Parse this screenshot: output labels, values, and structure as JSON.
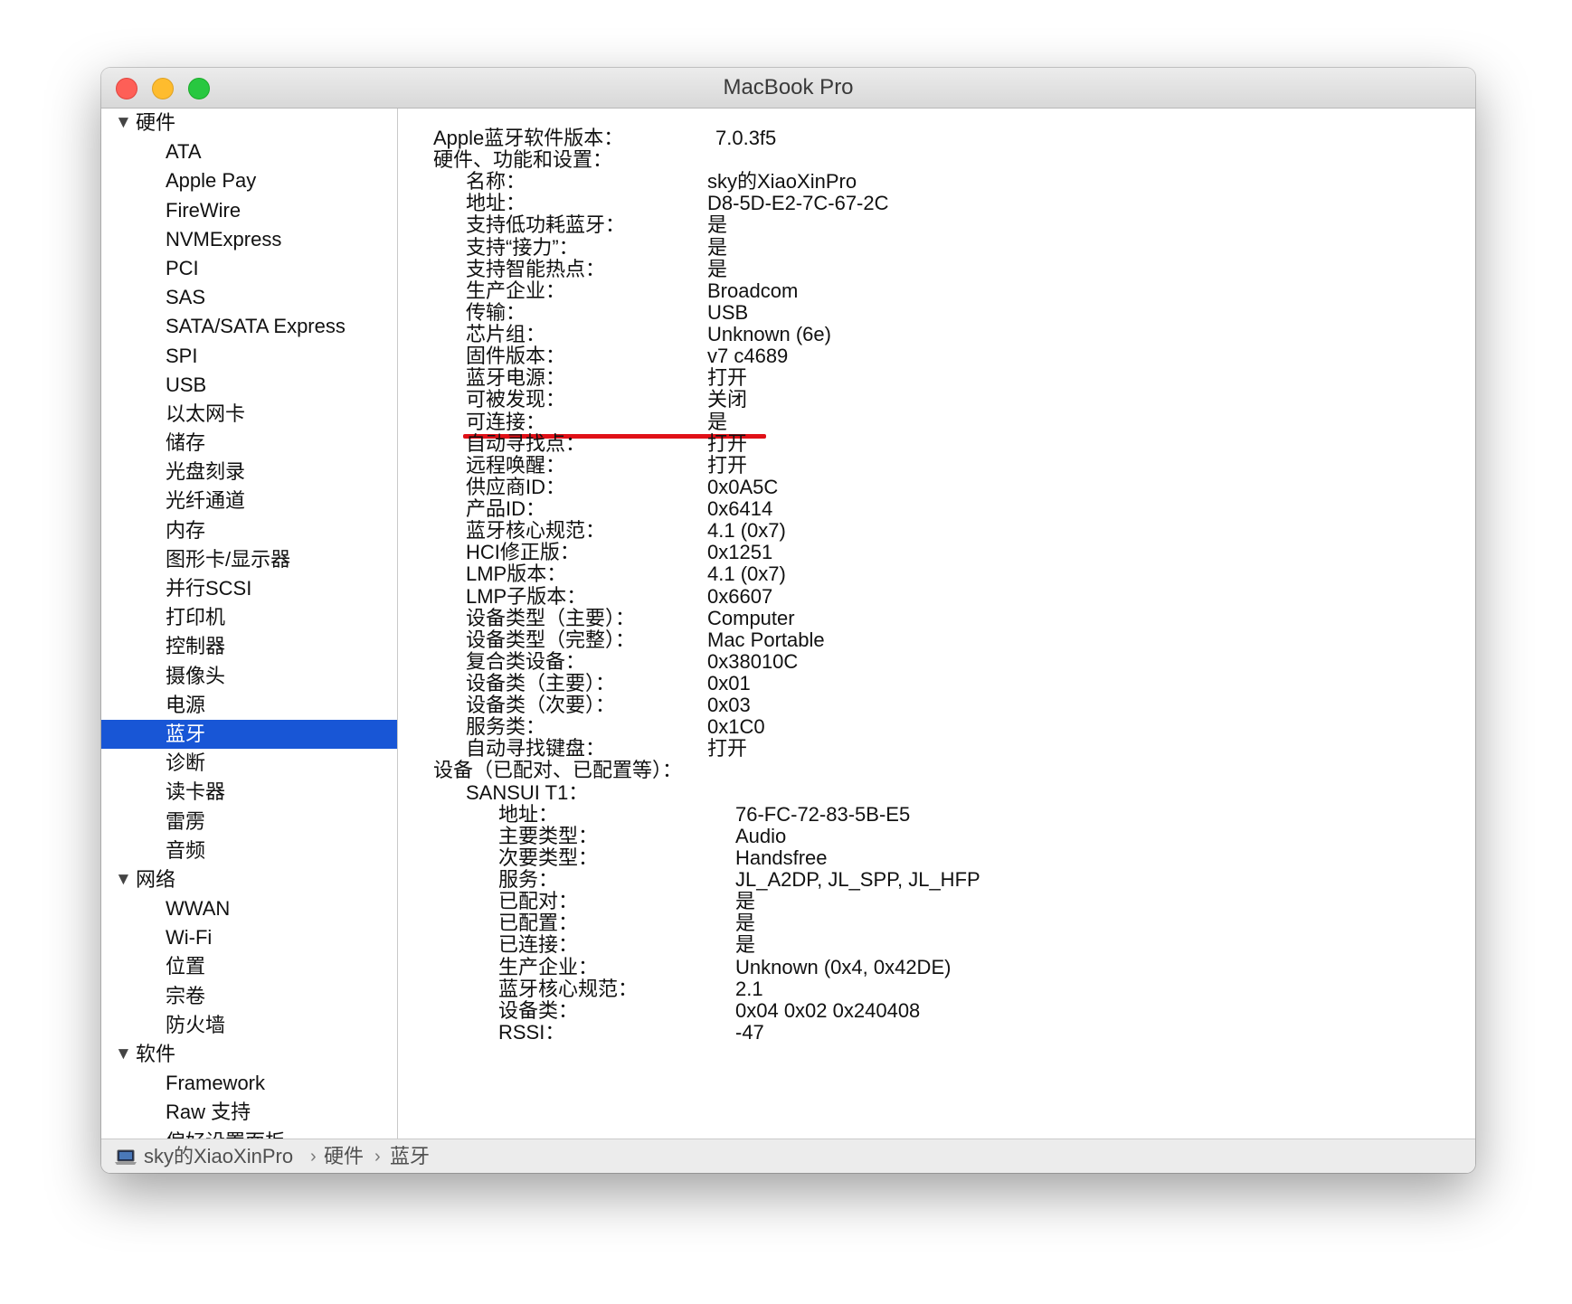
{
  "window": {
    "title": "MacBook Pro"
  },
  "sidebar": {
    "selected": "蓝牙",
    "rows": [
      {
        "type": "section",
        "label": "硬件"
      },
      {
        "type": "item",
        "label": "ATA"
      },
      {
        "type": "item",
        "label": "Apple Pay"
      },
      {
        "type": "item",
        "label": "FireWire"
      },
      {
        "type": "item",
        "label": "NVMExpress"
      },
      {
        "type": "item",
        "label": "PCI"
      },
      {
        "type": "item",
        "label": "SAS"
      },
      {
        "type": "item",
        "label": "SATA/SATA Express"
      },
      {
        "type": "item",
        "label": "SPI"
      },
      {
        "type": "item",
        "label": "USB"
      },
      {
        "type": "item",
        "label": "以太网卡"
      },
      {
        "type": "item",
        "label": "储存"
      },
      {
        "type": "item",
        "label": "光盘刻录"
      },
      {
        "type": "item",
        "label": "光纤通道"
      },
      {
        "type": "item",
        "label": "内存"
      },
      {
        "type": "item",
        "label": "图形卡/显示器"
      },
      {
        "type": "item",
        "label": "并行SCSI"
      },
      {
        "type": "item",
        "label": "打印机"
      },
      {
        "type": "item",
        "label": "控制器"
      },
      {
        "type": "item",
        "label": "摄像头"
      },
      {
        "type": "item",
        "label": "电源"
      },
      {
        "type": "item",
        "label": "蓝牙",
        "selected": true
      },
      {
        "type": "item",
        "label": "诊断"
      },
      {
        "type": "item",
        "label": "读卡器"
      },
      {
        "type": "item",
        "label": "雷雳"
      },
      {
        "type": "item",
        "label": "音频"
      },
      {
        "type": "section",
        "label": "网络"
      },
      {
        "type": "item",
        "label": "WWAN"
      },
      {
        "type": "item",
        "label": "Wi-Fi"
      },
      {
        "type": "item",
        "label": "位置"
      },
      {
        "type": "item",
        "label": "宗卷"
      },
      {
        "type": "item",
        "label": "防火墙"
      },
      {
        "type": "section",
        "label": "软件"
      },
      {
        "type": "item",
        "label": "Framework"
      },
      {
        "type": "item",
        "label": "Raw 支持"
      },
      {
        "type": "item",
        "label": "偏好设置面板"
      }
    ]
  },
  "details": {
    "rows": [
      {
        "indent": 0,
        "key": "Apple蓝牙软件版本：",
        "value": "7.0.3f5"
      },
      {
        "indent": 0,
        "key": "硬件、功能和设置：",
        "value": ""
      },
      {
        "indent": 1,
        "key": "名称：",
        "value": "sky的XiaoXinPro"
      },
      {
        "indent": 1,
        "key": "地址：",
        "value": "D8-5D-E2-7C-67-2C"
      },
      {
        "indent": 1,
        "key": "支持低功耗蓝牙：",
        "value": "是"
      },
      {
        "indent": 1,
        "key": "支持“接力”：",
        "value": "是"
      },
      {
        "indent": 1,
        "key": "支持智能热点：",
        "value": "是"
      },
      {
        "indent": 1,
        "key": "生产企业：",
        "value": "Broadcom"
      },
      {
        "indent": 1,
        "key": "传输：",
        "value": "USB"
      },
      {
        "indent": 1,
        "key": "芯片组：",
        "value": "Unknown (6e)"
      },
      {
        "indent": 1,
        "key": "固件版本：",
        "value": "v7 c4689",
        "highlight": true
      },
      {
        "indent": 1,
        "key": "蓝牙电源：",
        "value": "打开"
      },
      {
        "indent": 1,
        "key": "可被发现：",
        "value": "关闭"
      },
      {
        "indent": 1,
        "key": "可连接：",
        "value": "是"
      },
      {
        "indent": 1,
        "key": "自动寻找点：",
        "value": "打开"
      },
      {
        "indent": 1,
        "key": "远程唤醒：",
        "value": "打开"
      },
      {
        "indent": 1,
        "key": "供应商ID：",
        "value": "0x0A5C"
      },
      {
        "indent": 1,
        "key": "产品ID：",
        "value": "0x6414"
      },
      {
        "indent": 1,
        "key": "蓝牙核心规范：",
        "value": "4.1 (0x7)"
      },
      {
        "indent": 1,
        "key": "HCI修正版：",
        "value": "0x1251"
      },
      {
        "indent": 1,
        "key": "LMP版本：",
        "value": "4.1 (0x7)"
      },
      {
        "indent": 1,
        "key": "LMP子版本：",
        "value": "0x6607"
      },
      {
        "indent": 1,
        "key": "设备类型（主要）：",
        "value": "Computer"
      },
      {
        "indent": 1,
        "key": "设备类型（完整）：",
        "value": "Mac Portable"
      },
      {
        "indent": 1,
        "key": "复合类设备：",
        "value": "0x38010C"
      },
      {
        "indent": 1,
        "key": "设备类（主要）：",
        "value": "0x01"
      },
      {
        "indent": 1,
        "key": "设备类（次要）：",
        "value": "0x03"
      },
      {
        "indent": 1,
        "key": "服务类：",
        "value": "0x1C0"
      },
      {
        "indent": 1,
        "key": "自动寻找键盘：",
        "value": "打开"
      },
      {
        "indent": 0,
        "key": "设备（已配对、已配置等）：",
        "value": ""
      },
      {
        "indent": 1,
        "key": "SANSUI T1：",
        "value": ""
      },
      {
        "indent": 2,
        "key": "地址：",
        "value": "76-FC-72-83-5B-E5"
      },
      {
        "indent": 2,
        "key": "主要类型：",
        "value": "Audio"
      },
      {
        "indent": 2,
        "key": "次要类型：",
        "value": "Handsfree"
      },
      {
        "indent": 2,
        "key": "服务：",
        "value": "JL_A2DP, JL_SPP, JL_HFP"
      },
      {
        "indent": 2,
        "key": "已配对：",
        "value": "是"
      },
      {
        "indent": 2,
        "key": "已配置：",
        "value": "是"
      },
      {
        "indent": 2,
        "key": "已连接：",
        "value": "是"
      },
      {
        "indent": 2,
        "key": "生产企业：",
        "value": "Unknown (0x4, 0x42DE)"
      },
      {
        "indent": 2,
        "key": "蓝牙核心规范：",
        "value": "2.1"
      },
      {
        "indent": 2,
        "key": "设备类：",
        "value": "0x04 0x02 0x240408"
      },
      {
        "indent": 2,
        "key": "RSSI：",
        "value": "-47"
      }
    ]
  },
  "pathbar": {
    "icon": "laptop-icon",
    "crumbs": [
      "sky的XiaoXinPro",
      "硬件",
      "蓝牙"
    ],
    "separator": "›"
  },
  "colors": {
    "selection": "#1856d6",
    "annotation": "#e01017"
  }
}
